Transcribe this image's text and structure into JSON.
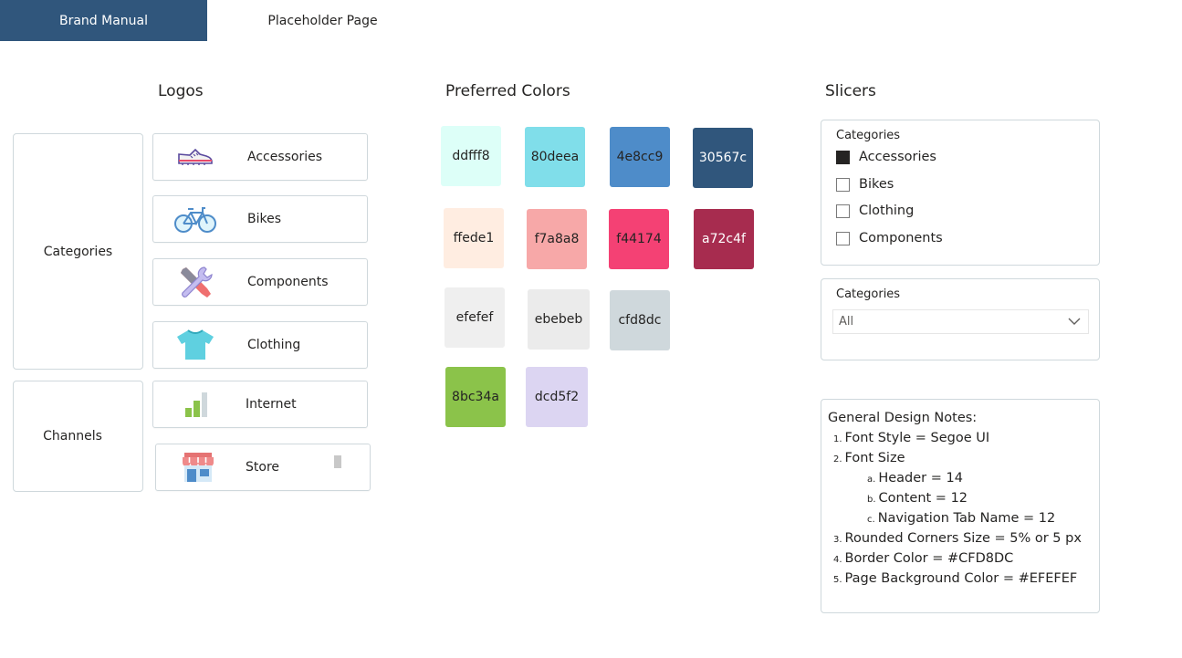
{
  "tabs": {
    "brand_manual": "Brand Manual",
    "placeholder_page": "Placeholder Page"
  },
  "headings": {
    "logos": "Logos",
    "colors": "Preferred Colors",
    "slicers": "Slicers"
  },
  "groups": {
    "categories": "Categories",
    "channels": "Channels"
  },
  "logos": {
    "accessories": "Accessories",
    "bikes": "Bikes",
    "components": "Components",
    "clothing": "Clothing",
    "internet": "Internet",
    "store": "Store"
  },
  "colors": [
    {
      "hex": "ddfff8"
    },
    {
      "hex": "80deea"
    },
    {
      "hex": "4e8cc9"
    },
    {
      "hex": "30567c"
    },
    {
      "hex": "ffede1"
    },
    {
      "hex": "f7a8a8"
    },
    {
      "hex": "f44174"
    },
    {
      "hex": "a72c4f"
    },
    {
      "hex": "efefef"
    },
    {
      "hex": "ebebeb"
    },
    {
      "hex": "cfd8dc"
    },
    {
      "hex": "8bc34a"
    },
    {
      "hex": "dcd5f2"
    }
  ],
  "slicer_list": {
    "title": "Categories",
    "items": [
      {
        "label": "Accessories",
        "checked": true
      },
      {
        "label": "Bikes",
        "checked": false
      },
      {
        "label": "Clothing",
        "checked": false
      },
      {
        "label": "Components",
        "checked": false
      }
    ]
  },
  "slicer_dropdown": {
    "title": "Categories",
    "value": "All"
  },
  "notes": {
    "title": "General Design Notes:",
    "n1_num": "1.",
    "n1": "Font Style = Segoe UI",
    "n2_num": "2.",
    "n2": "Font Size",
    "n2a_num": "a.",
    "n2a": "Header = 14",
    "n2b_num": "b.",
    "n2b": "Content = 12",
    "n2c_num": "c.",
    "n2c": "Navigation Tab Name = 12",
    "n3_num": "3.",
    "n3": "Rounded Corners Size = 5% or 5 px",
    "n4_num": "4.",
    "n4": "Border Color = #CFD8DC",
    "n5_num": "5.",
    "n5": "Page Background Color = #EFEFEF"
  },
  "theme": {
    "accent": "#30567c",
    "border": "#cfd8dc"
  },
  "icons": [
    "shoe-icon",
    "bike-icon",
    "wrench-screwdriver-icon",
    "tshirt-icon",
    "bar-chart-icon",
    "store-icon"
  ]
}
